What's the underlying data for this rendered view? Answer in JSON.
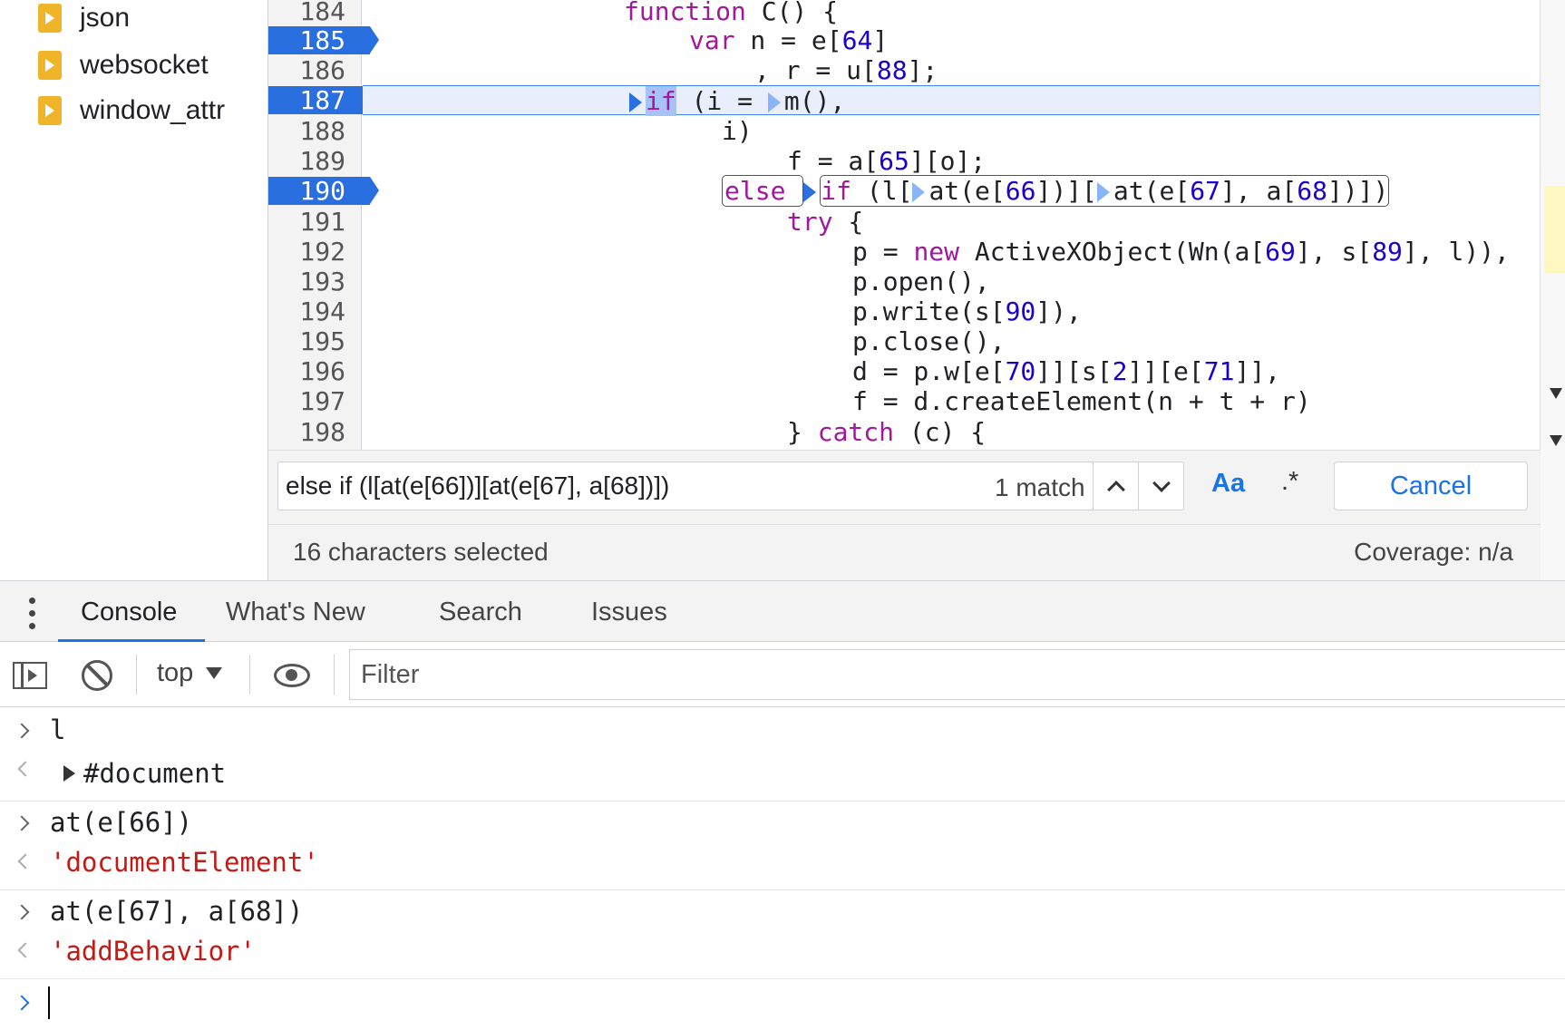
{
  "file_tree": {
    "items": [
      {
        "label": "json",
        "icon": "js-file-icon"
      },
      {
        "label": "websocket",
        "icon": "js-file-icon"
      },
      {
        "label": "window_attr",
        "icon": "js-file-icon"
      }
    ]
  },
  "editor": {
    "line_numbers": [
      "184",
      "185",
      "186",
      "187",
      "188",
      "189",
      "190",
      "191",
      "192",
      "193",
      "194",
      "195",
      "196",
      "197",
      "198"
    ],
    "breakpoint_lines": [
      "185",
      "187",
      "190"
    ],
    "current_execution_line": "187"
  },
  "find_bar": {
    "query": "else if (l[at(e[66])][at(e[67], a[68])])",
    "match_count": "1 match",
    "case_label": "Aa",
    "regex_label": ".*",
    "cancel_label": "Cancel"
  },
  "status_bar": {
    "selection": "16 characters selected",
    "coverage": "Coverage: n/a"
  },
  "drawer": {
    "tabs": [
      "Console",
      "What's New",
      "Search",
      "Issues"
    ],
    "active_tab": "Console"
  },
  "console_toolbar": {
    "context": "top",
    "filter_placeholder": "Filter"
  },
  "console": {
    "entries": [
      {
        "input": "l",
        "output": "#document"
      },
      {
        "input": "at(e[66])",
        "output": "'documentElement'"
      },
      {
        "input": "at(e[67], a[68])",
        "output": "'addBehavior'"
      }
    ]
  },
  "colors": {
    "breakpoint": "#2a6fe0",
    "keyword": "#a1189c",
    "number": "#1c00cf",
    "string": "#c41a16",
    "accent": "#1a73e8",
    "exec_line_bg": "#e8eefc"
  }
}
